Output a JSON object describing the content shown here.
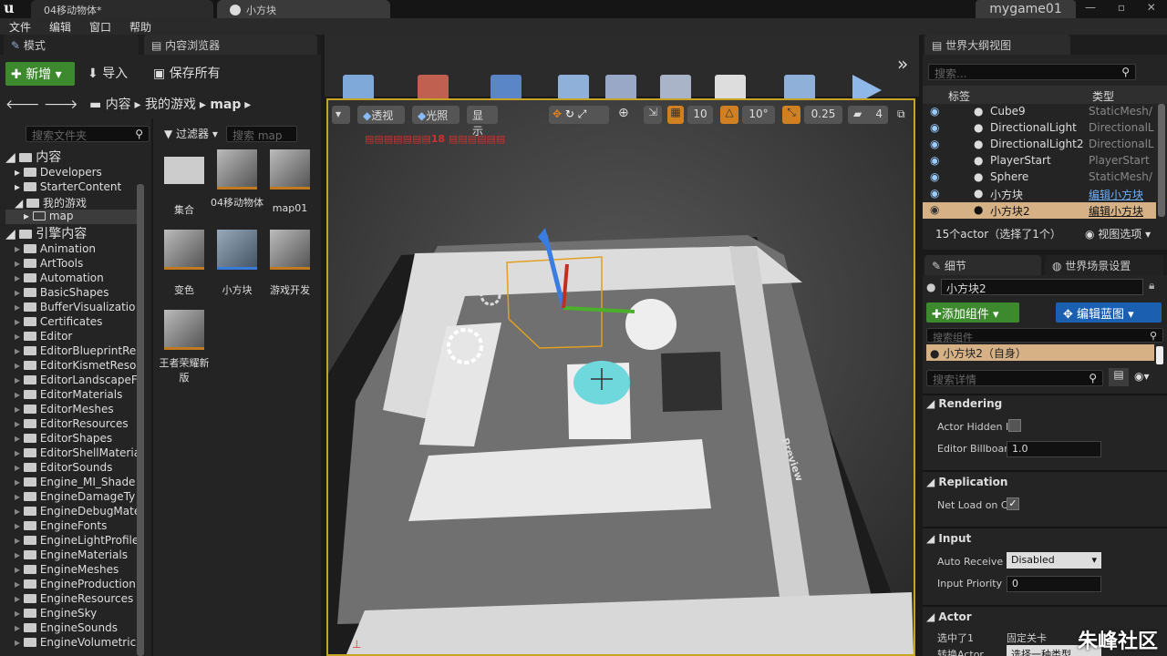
{
  "window": {
    "tab1": "04移动物体*",
    "tab2": "小方块",
    "project": "mygame01",
    "win_controls": "— ▫ ✕"
  },
  "menubar": [
    "文件",
    "编辑",
    "窗口",
    "帮助"
  ],
  "modes_tab": "模式",
  "content_browser": {
    "tab": "内容浏览器",
    "add_new": "新增",
    "import": "导入",
    "save_all": "保存所有",
    "breadcrumb": [
      "内容",
      "我的游戏",
      "map"
    ],
    "search_folders_placeholder": "搜索文件夹",
    "filters": "过滤器",
    "search_assets_placeholder": "搜索 map",
    "tree_root": "内容",
    "tree": [
      "Developers",
      "StarterContent",
      "我的游戏",
      "map"
    ],
    "engine_root": "引擎内容",
    "engine_tree": [
      "Animation",
      "ArtTools",
      "Automation",
      "BasicShapes",
      "BufferVisualizatio",
      "Certificates",
      "Editor",
      "EditorBlueprintRes",
      "EditorKismetReso",
      "EditorLandscapeF",
      "EditorMaterials",
      "EditorMeshes",
      "EditorResources",
      "EditorShapes",
      "EditorShellMateria",
      "EditorSounds",
      "Engine_MI_Shade",
      "EngineDamageTy",
      "EngineDebugMate",
      "EngineFonts",
      "EngineLightProfile",
      "EngineMaterials",
      "EngineMeshes",
      "EngineProduction",
      "EngineResources",
      "EngineSky",
      "EngineSounds",
      "EngineVolumetric:"
    ],
    "assets": [
      {
        "label": "集合",
        "kind": "folder"
      },
      {
        "label": "04移动物体",
        "kind": "map"
      },
      {
        "label": "map01",
        "kind": "map"
      },
      {
        "label": "变色",
        "kind": "map"
      },
      {
        "label": "小方块",
        "kind": "blueprint"
      },
      {
        "label": "游戏开发",
        "kind": "map"
      },
      {
        "label": "王者荣耀新版",
        "kind": "map"
      }
    ]
  },
  "toolbar": [
    {
      "label": "保存当前关卡",
      "icon": "save-icon",
      "color": "#7fa9d8"
    },
    {
      "label": "源码管理",
      "icon": "source-control-icon",
      "color": "#c06050"
    },
    {
      "label": "内容",
      "icon": "content-icon",
      "color": "#5a86c8"
    },
    {
      "label": "虚幻商城",
      "icon": "marketplace-icon",
      "color": "#8fb0d8"
    },
    {
      "label": "设置",
      "icon": "settings-icon",
      "color": "#9aa8c8"
    },
    {
      "label": "蓝图",
      "icon": "blueprint-icon",
      "color": "#aab4c8"
    },
    {
      "label": "过场动画",
      "icon": "cinematics-icon",
      "color": "#ddd"
    },
    {
      "label": "构建",
      "icon": "build-icon",
      "color": "#8fb0d8"
    },
    {
      "label": "播放",
      "icon": "play-icon",
      "color": "#8fb8e8"
    }
  ],
  "viewport": {
    "perspective": "透视",
    "lit": "光照",
    "show": "显示",
    "grid_snap": "10",
    "rot_snap": "10°",
    "scale_snap": "0.25",
    "cam_speed": "4",
    "stat_text": "▤▤▤▤▤▤▤18 ▤▤▤▤▤▤",
    "preview": "Preview"
  },
  "outliner": {
    "tab": "世界大纲视图",
    "search_placeholder": "搜索...",
    "col_label": "标签",
    "col_type": "类型",
    "rows": [
      {
        "name": "Cube9",
        "type": "StaticMesh/"
      },
      {
        "name": "DirectionalLight",
        "type": "DirectionalL"
      },
      {
        "name": "DirectionalLight2",
        "type": "DirectionalL"
      },
      {
        "name": "PlayerStart",
        "type": "PlayerStart"
      },
      {
        "name": "Sphere",
        "type": "StaticMesh/"
      },
      {
        "name": "小方块",
        "type": "编辑小方块"
      },
      {
        "name": "小方块2",
        "type": "编辑小方块"
      }
    ],
    "status": "15个actor（选择了1个）",
    "view_options": "视图选项"
  },
  "details": {
    "tab": "细节",
    "tab2": "世界场景设置",
    "object_name": "小方块2",
    "add_component": "添加组件",
    "edit_blueprint": "编辑蓝图",
    "search_components_placeholder": "搜索组件",
    "self_item": "小方块2（自身）",
    "search_details_placeholder": "搜索详情",
    "sections": {
      "rendering": "Rendering",
      "actor_hidden": "Actor Hidden I",
      "billboard": "Editor Billboar",
      "billboard_value": "1.0",
      "replication": "Replication",
      "net_load": "Net Load on C",
      "input": "Input",
      "auto_receive": "Auto Receive I",
      "auto_receive_value": "Disabled",
      "input_priority": "Input Priority",
      "input_priority_value": "0",
      "actor": "Actor",
      "selected_in": "选中了1",
      "selected_value": "固定关卡",
      "convert_actor": "转换Actor",
      "convert_value": "选择一种类型"
    }
  },
  "watermark": "朱峰社区"
}
